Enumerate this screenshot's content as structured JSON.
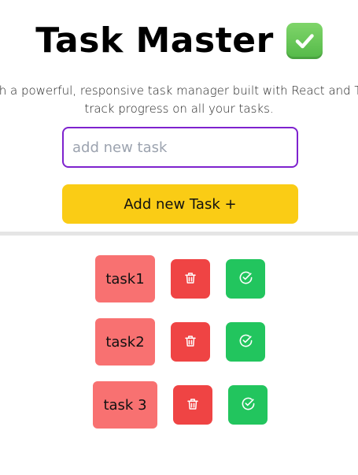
{
  "header": {
    "title": "Task Master",
    "emoji_icon": "check-mark-button-icon",
    "subtitle_line1": "ith a powerful, responsive task manager built with React and Ta",
    "subtitle_line2": "track progress on all your tasks."
  },
  "form": {
    "input_value": "",
    "input_placeholder": "add new task",
    "add_button_label": "Add new Task +"
  },
  "tasks": [
    {
      "label": "task1"
    },
    {
      "label": "task2"
    },
    {
      "label": "task 3"
    }
  ],
  "icons": {
    "delete": "trash-icon",
    "complete": "check-circle-icon"
  },
  "colors": {
    "input_border": "#7e22ce",
    "add_button": "#facc15",
    "task_label": "#f87171",
    "delete_button": "#ef4444",
    "complete_button": "#22c55e",
    "divider": "#e5e5e5"
  }
}
